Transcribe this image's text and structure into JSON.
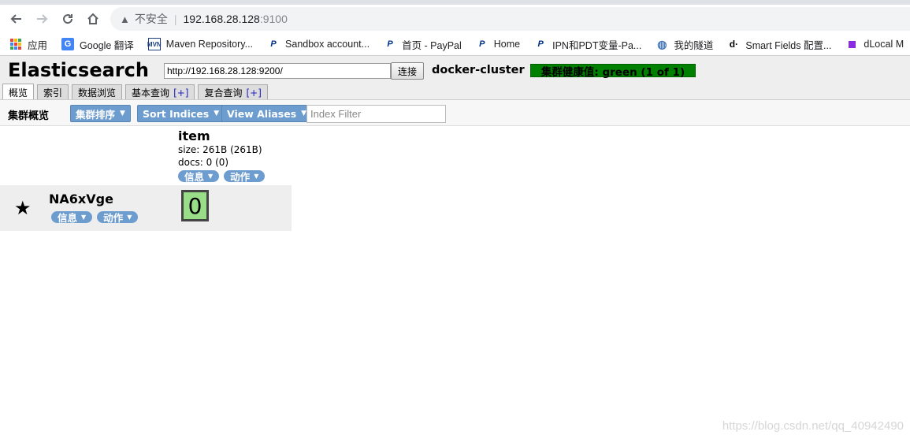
{
  "browser": {
    "insecure_label": "不安全",
    "url_host": "192.168.28.128",
    "url_port": ":9100",
    "bookmarks": [
      {
        "label": "应用",
        "icon": "apps-grid-icon"
      },
      {
        "label": "Google 翻译",
        "icon": "google-translate-icon"
      },
      {
        "label": "Maven Repository...",
        "icon": "maven-icon"
      },
      {
        "label": "Sandbox account...",
        "icon": "paypal-icon"
      },
      {
        "label": "首页 - PayPal",
        "icon": "paypal-icon"
      },
      {
        "label": "Home",
        "icon": "paypal-icon"
      },
      {
        "label": "IPN和PDT变量-Pa...",
        "icon": "paypal-icon"
      },
      {
        "label": "我的隧道",
        "icon": "globe-icon"
      },
      {
        "label": "Smart Fields 配置...",
        "icon": "dlocal-icon"
      },
      {
        "label": "dLocal M",
        "icon": "purple-square-icon"
      }
    ]
  },
  "header": {
    "title": "Elasticsearch",
    "connect_url": "http://192.168.28.128:9200/",
    "connect_label": "连接",
    "cluster_name": "docker-cluster",
    "health": "集群健康值: green (1 of 1)",
    "health_color": "#008000"
  },
  "tabs": [
    {
      "label": "概览",
      "plus": ""
    },
    {
      "label": "索引",
      "plus": ""
    },
    {
      "label": "数据浏览",
      "plus": ""
    },
    {
      "label": "基本查询",
      "plus": "[+]"
    },
    {
      "label": "复合查询",
      "plus": "[+]"
    }
  ],
  "toolbar": {
    "label": "集群概览",
    "sort_cluster": "集群排序",
    "sort_indices": "Sort Indices",
    "view_aliases": "View Aliases",
    "filter_placeholder": "Index Filter"
  },
  "index": {
    "name": "item",
    "size": "size: 261B (261B)",
    "docs": "docs: 0 (0)",
    "info_label": "信息",
    "action_label": "动作"
  },
  "node": {
    "name": "NA6xVge",
    "info_label": "信息",
    "action_label": "动作",
    "shard": "0",
    "shard_color": "#99dd88"
  },
  "watermark": "https://blog.csdn.net/qq_40942490"
}
